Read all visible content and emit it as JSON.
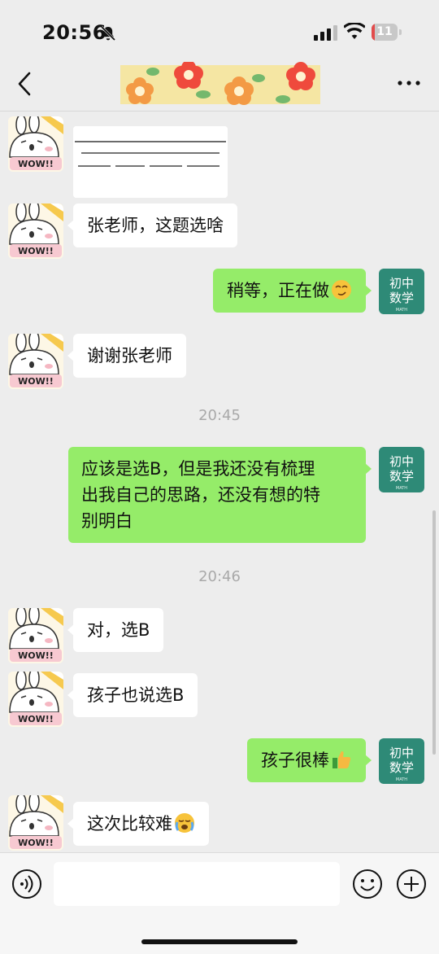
{
  "status_bar": {
    "time": "20:56",
    "battery_level": "11",
    "battery_fraction": 0.11,
    "icons": [
      "bell-slash-icon",
      "cellular-signal-icon",
      "wifi-icon",
      "battery-icon"
    ]
  },
  "nav": {
    "back_icon": "chevron-left-icon",
    "more_icon": "more-dots-icon",
    "banner": "flower-banner"
  },
  "contact_avatar": {
    "text": "WOW!!"
  },
  "my_avatar": {
    "line1": "初中",
    "line2": "数学",
    "small": "MATH"
  },
  "messages": [
    {
      "type": "image",
      "side": "left"
    },
    {
      "type": "text",
      "side": "left",
      "text": "张老师，这题选啥"
    },
    {
      "type": "text",
      "side": "right",
      "text": "稍等，正在做",
      "emoji": "smirking-face-emoji"
    },
    {
      "type": "text",
      "side": "left",
      "text": "谢谢张老师"
    },
    {
      "type": "time",
      "text": "20:45"
    },
    {
      "type": "text",
      "side": "right",
      "lines": [
        "应该是选B，但是我还没有梳理",
        "出我自己的思路，还没有想的特",
        "别明白"
      ]
    },
    {
      "type": "time",
      "text": "20:46"
    },
    {
      "type": "text",
      "side": "left",
      "text": "对，选B"
    },
    {
      "type": "text",
      "side": "left",
      "text": "孩子也说选B"
    },
    {
      "type": "text",
      "side": "right",
      "text": "孩子很棒",
      "emoji": "thumbs-up-emoji"
    },
    {
      "type": "text",
      "side": "left",
      "text": "这次比较难",
      "emoji": "crying-face-emoji"
    }
  ],
  "input": {
    "placeholder": "",
    "icons": [
      "voice-icon",
      "emoji-icon",
      "plus-icon"
    ]
  },
  "colors": {
    "background": "#ededed",
    "outgoing_bubble": "#95ec69",
    "incoming_bubble": "#ffffff",
    "my_avatar": "#2e8a77"
  }
}
